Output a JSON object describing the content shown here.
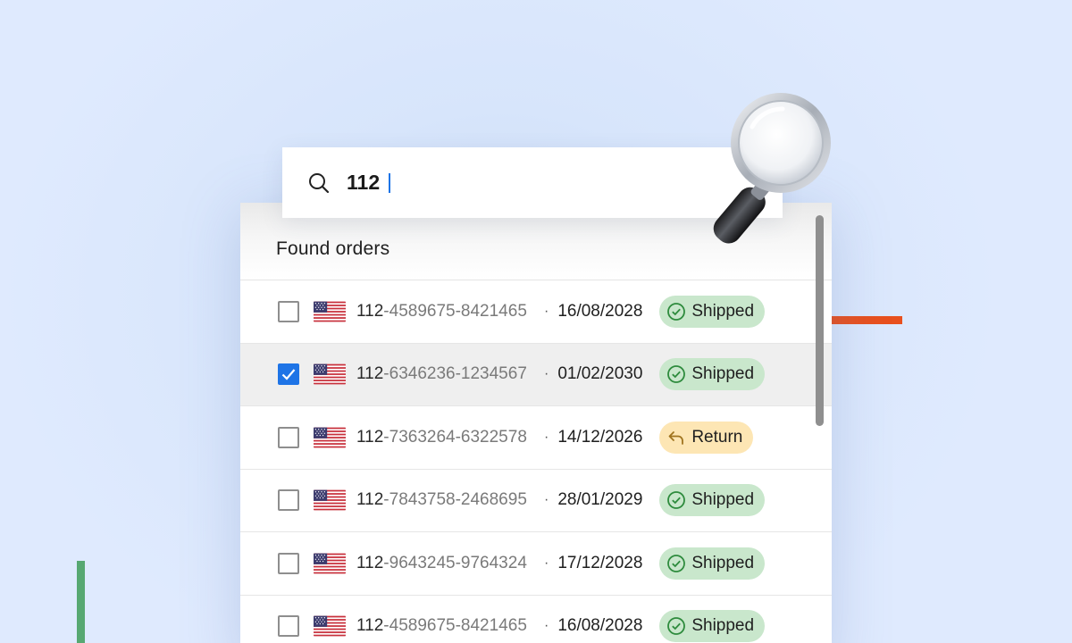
{
  "search": {
    "query": "112",
    "icon": "search-icon"
  },
  "panel": {
    "title": "Found orders"
  },
  "orders": [
    {
      "prefix": "112",
      "rest": "-4589675-8421465",
      "date": "16/08/2028",
      "status": "Shipped",
      "status_type": "shipped",
      "checked": false
    },
    {
      "prefix": "112",
      "rest": "-6346236-1234567",
      "date": "01/02/2030",
      "status": "Shipped",
      "status_type": "shipped",
      "checked": true
    },
    {
      "prefix": "112",
      "rest": "-7363264-6322578",
      "date": "14/12/2026",
      "status": "Return",
      "status_type": "return",
      "checked": false
    },
    {
      "prefix": "112",
      "rest": "-7843758-2468695",
      "date": "28/01/2029",
      "status": "Shipped",
      "status_type": "shipped",
      "checked": false
    },
    {
      "prefix": "112",
      "rest": "-9643245-9764324",
      "date": "17/12/2028",
      "status": "Shipped",
      "status_type": "shipped",
      "checked": false
    },
    {
      "prefix": "112",
      "rest": "-4589675-8421465",
      "date": "16/08/2028",
      "status": "Shipped",
      "status_type": "shipped",
      "checked": false
    }
  ],
  "separator": "·",
  "colors": {
    "accent": "#1e74e6",
    "shipped_bg": "#c9e7cc",
    "return_bg": "#fde6b4",
    "shipped_icon": "#2e8b3d",
    "return_icon": "#a0741f"
  },
  "icons": {
    "flag": "us-flag-icon",
    "shipped": "check-circle-icon",
    "return": "return-arrow-icon",
    "decor": "magnifying-glass-icon"
  }
}
